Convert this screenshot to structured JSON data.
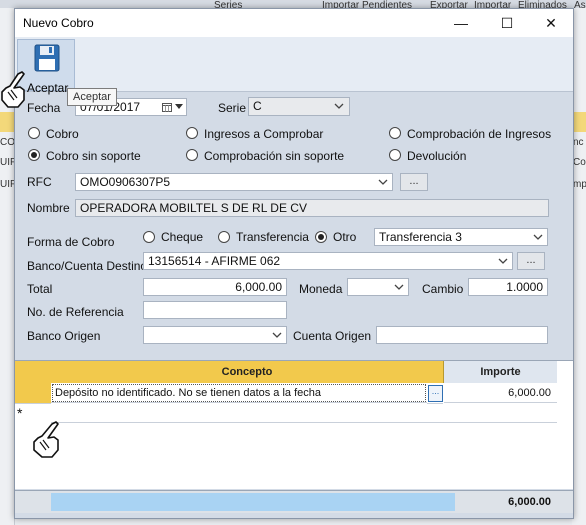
{
  "background": {
    "menu_fragments": [
      "Series",
      "Importar Pendientes",
      "Exportar",
      "Importar",
      "Eliminados",
      "As"
    ],
    "left_fragments": [
      "CO",
      "UIF",
      "UIF"
    ],
    "right_fragments": [
      "nc",
      "Co",
      "mp"
    ]
  },
  "window": {
    "title": "Nuevo Cobro",
    "minimize": "—",
    "maximize": "☐",
    "close": "✕"
  },
  "toolbar": {
    "accept_label": "Aceptar",
    "tooltip": "Aceptar"
  },
  "form": {
    "fecha_label": "Fecha",
    "fecha_value": "07/01/2017",
    "serie_label": "Serie",
    "serie_value": "C",
    "radios": {
      "cobro": "Cobro",
      "ingresos_comprobar": "Ingresos a Comprobar",
      "comprobacion_ingresos": "Comprobación de Ingresos",
      "cobro_sin_soporte": "Cobro sin soporte",
      "comprobacion_sin_soporte": "Comprobación sin soporte",
      "devolucion": "Devolución"
    },
    "rfc_label": "RFC",
    "rfc_value": "OMO0906307P5",
    "ellipsis": "...",
    "nombre_label": "Nombre",
    "nombre_value": "OPERADORA MOBILTEL S DE RL DE CV",
    "forma_cobro_label": "Forma de Cobro",
    "forma": {
      "cheque": "Cheque",
      "transferencia": "Transferencia",
      "otro": "Otro"
    },
    "forma_combo_value": "Transferencia  3",
    "banco_destino_label": "Banco/Cuenta Destino",
    "banco_destino_value": "13156514 - AFIRME  062",
    "total_label": "Total",
    "total_value": "6,000.00",
    "moneda_label": "Moneda",
    "moneda_value": "",
    "cambio_label": "Cambio",
    "cambio_value": "1.0000",
    "referencia_label": "No. de Referencia",
    "referencia_value": "",
    "banco_origen_label": "Banco Origen",
    "banco_origen_value": "",
    "cuenta_origen_label": "Cuenta Origen",
    "cuenta_origen_value": ""
  },
  "grid": {
    "columns": [
      "Concepto",
      "Importe"
    ],
    "rows": [
      {
        "concepto": "Depósito no identificado. No se tienen datos a la fecha",
        "importe": "6,000.00"
      }
    ],
    "new_row_marker": "*",
    "footer_total": "6,000.00"
  },
  "colors": {
    "grid_header": "#f2c94c",
    "footer_bar": "#a9d3f3",
    "dialog_bg": "#d3dbe6"
  }
}
